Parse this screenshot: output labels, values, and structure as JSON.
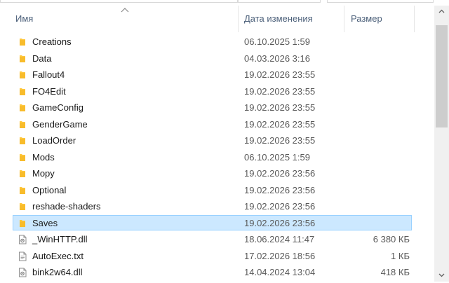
{
  "columns": {
    "name": "Имя",
    "date": "Дата изменения",
    "size": "Размер"
  },
  "sort": {
    "column": "name",
    "direction": "ascending",
    "icon": "chevron-up-icon"
  },
  "files": [
    {
      "name": "Creations",
      "date": "06.10.2025 1:59",
      "size": "",
      "kind": "folder",
      "icon": "folder-icon"
    },
    {
      "name": "Data",
      "date": "04.03.2026 3:16",
      "size": "",
      "kind": "folder",
      "icon": "folder-icon"
    },
    {
      "name": "Fallout4",
      "date": "19.02.2026 23:55",
      "size": "",
      "kind": "folder",
      "icon": "folder-icon"
    },
    {
      "name": "FO4Edit",
      "date": "19.02.2026 23:55",
      "size": "",
      "kind": "folder",
      "icon": "folder-icon"
    },
    {
      "name": "GameConfig",
      "date": "19.02.2026 23:55",
      "size": "",
      "kind": "folder",
      "icon": "folder-icon"
    },
    {
      "name": "GenderGame",
      "date": "19.02.2026 23:55",
      "size": "",
      "kind": "folder",
      "icon": "folder-icon"
    },
    {
      "name": "LoadOrder",
      "date": "19.02.2026 23:55",
      "size": "",
      "kind": "folder",
      "icon": "folder-icon"
    },
    {
      "name": "Mods",
      "date": "06.10.2025 1:59",
      "size": "",
      "kind": "folder",
      "icon": "folder-icon"
    },
    {
      "name": "Mopy",
      "date": "19.02.2026 23:56",
      "size": "",
      "kind": "folder",
      "icon": "folder-icon"
    },
    {
      "name": "Optional",
      "date": "19.02.2026 23:56",
      "size": "",
      "kind": "folder",
      "icon": "folder-icon"
    },
    {
      "name": "reshade-shaders",
      "date": "19.02.2026 23:56",
      "size": "",
      "kind": "folder",
      "icon": "folder-icon"
    },
    {
      "name": "Saves",
      "date": "19.02.2026 23:56",
      "size": "",
      "kind": "folder",
      "icon": "folder-icon",
      "selected": true
    },
    {
      "name": "_WinHTTP.dll",
      "date": "18.06.2024 11:47",
      "size": "6 380 КБ",
      "kind": "dll",
      "icon": "dll-file-icon"
    },
    {
      "name": "AutoExec.txt",
      "date": "17.02.2026 18:56",
      "size": "1 КБ",
      "kind": "txt",
      "icon": "text-file-icon"
    },
    {
      "name": "bink2w64.dll",
      "date": "14.04.2024 13:04",
      "size": "418 КБ",
      "kind": "dll",
      "icon": "dll-file-icon"
    }
  ],
  "colors": {
    "selection_bg": "#cce8ff",
    "selection_border": "#99d1ff",
    "folder": "#ffc83d",
    "header_text": "#4c607a"
  }
}
